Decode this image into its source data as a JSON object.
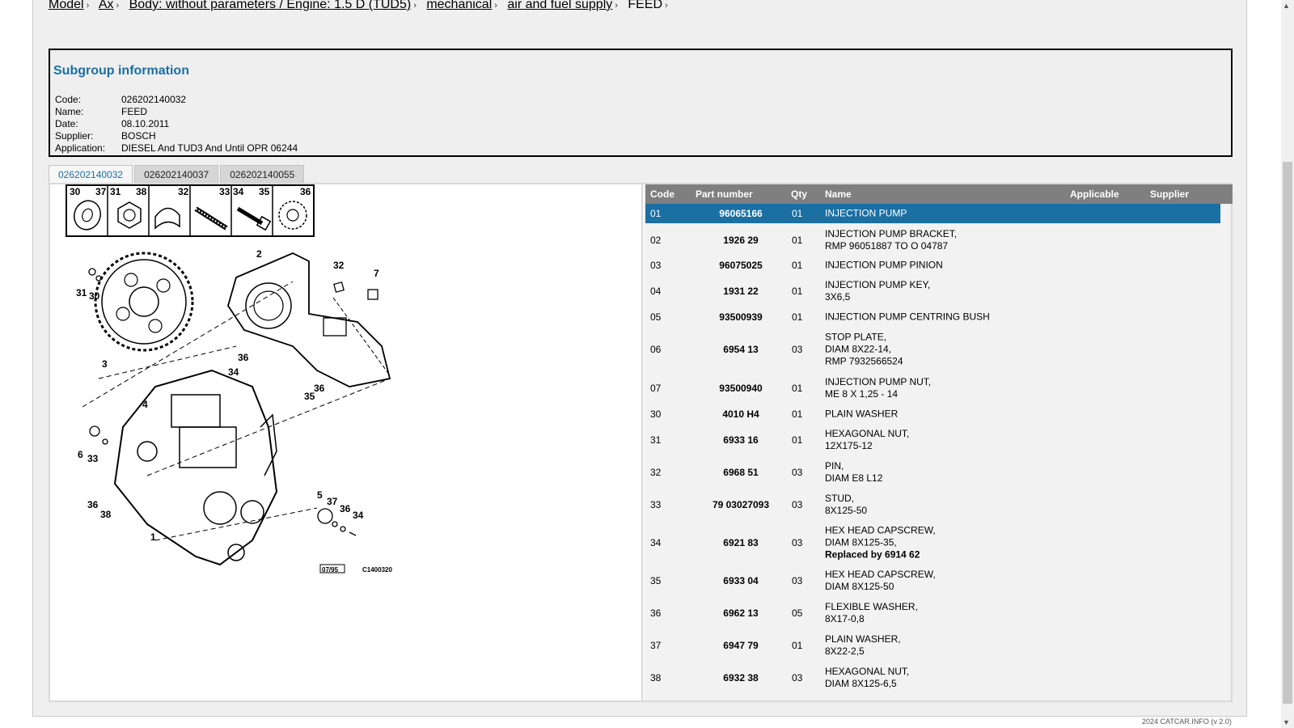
{
  "breadcrumb": {
    "items": [
      "Model",
      "Ax",
      "Body: without parameters / Engine: 1.5 D (TUD5)",
      "mechanical",
      "air and fuel supply"
    ],
    "current": "FEED",
    "separator": "›"
  },
  "subgroup": {
    "title": "Subgroup information",
    "fields": [
      {
        "label": "Code:",
        "value": "026202140032"
      },
      {
        "label": "Name:",
        "value": "FEED"
      },
      {
        "label": "Date:",
        "value": "08.10.2011"
      },
      {
        "label": "Supplier:",
        "value": "BOSCH"
      },
      {
        "label": "Application:",
        "value": "DIESEL And TUD3 And Until OPR 06244"
      }
    ]
  },
  "tabs": [
    {
      "label": "026202140032",
      "active": true
    },
    {
      "label": "026202140037",
      "active": false
    },
    {
      "label": "026202140055",
      "active": false
    }
  ],
  "diagram": {
    "legend_numbers": [
      "30",
      "37",
      "31",
      "38",
      "32",
      "33",
      "34",
      "35",
      "36"
    ],
    "callouts": [
      "2",
      "32",
      "7",
      "31",
      "30",
      "3",
      "36",
      "34",
      "4",
      "36",
      "35",
      "6",
      "33",
      "5",
      "37",
      "36",
      "34",
      "36",
      "38",
      "1"
    ],
    "stamp_date": "07/95",
    "ref_code": "C1400320"
  },
  "parts_table": {
    "columns": {
      "code": "Code",
      "part": "Part number",
      "qty": "Qty",
      "name": "Name",
      "applicable": "Applicable",
      "supplier": "Supplier"
    },
    "rows": [
      {
        "code": "01",
        "part": "96065166",
        "qty": "01",
        "name": [
          "INJECTION PUMP"
        ],
        "selected": true
      },
      {
        "code": "02",
        "part": "1926 29",
        "qty": "01",
        "name": [
          "INJECTION PUMP BRACKET,",
          "RMP 96051887 TO O 04787"
        ]
      },
      {
        "code": "03",
        "part": "96075025",
        "qty": "01",
        "name": [
          "INJECTION PUMP PINION"
        ]
      },
      {
        "code": "04",
        "part": "1931 22",
        "qty": "01",
        "name": [
          "INJECTION PUMP KEY,",
          "3X6,5"
        ]
      },
      {
        "code": "05",
        "part": "93500939",
        "qty": "01",
        "name": [
          "INJECTION PUMP CENTRING BUSH"
        ]
      },
      {
        "code": "06",
        "part": "6954 13",
        "qty": "03",
        "name": [
          "STOP PLATE,",
          "DIAM 8X22-14,",
          "RMP 7932566524"
        ]
      },
      {
        "code": "07",
        "part": "93500940",
        "qty": "01",
        "name": [
          "INJECTION PUMP NUT,",
          "ME 8 X 1,25 - 14"
        ]
      },
      {
        "code": "30",
        "part": "4010 H4",
        "qty": "01",
        "name": [
          "PLAIN WASHER"
        ]
      },
      {
        "code": "31",
        "part": "6933 16",
        "qty": "01",
        "name": [
          "HEXAGONAL NUT,",
          "12X175-12"
        ]
      },
      {
        "code": "32",
        "part": "6968 51",
        "qty": "03",
        "name": [
          "PIN,",
          "DIAM E8 L12"
        ]
      },
      {
        "code": "33",
        "part": "79 03027093",
        "qty": "03",
        "name": [
          "STUD,",
          "8X125-50"
        ]
      },
      {
        "code": "34",
        "part": "6921 83",
        "qty": "03",
        "name": [
          "HEX HEAD CAPSCREW,",
          "DIAM 8X125-35,"
        ],
        "replaced": "Replaced by 6914 62"
      },
      {
        "code": "35",
        "part": "6933 04",
        "qty": "03",
        "name": [
          "HEX HEAD CAPSCREW,",
          "DIAM 8X125-50"
        ]
      },
      {
        "code": "36",
        "part": "6962 13",
        "qty": "05",
        "name": [
          "FLEXIBLE WASHER,",
          "8X17-0,8"
        ]
      },
      {
        "code": "37",
        "part": "6947 79",
        "qty": "01",
        "name": [
          "PLAIN WASHER,",
          "8X22-2,5"
        ]
      },
      {
        "code": "38",
        "part": "6932 38",
        "qty": "03",
        "name": [
          "HEXAGONAL NUT,",
          "DIAM 8X125-6,5"
        ]
      }
    ]
  },
  "footer": "2024 CATCAR.INFO (v 2.0)",
  "colors": {
    "accent": "#1a6fa3",
    "header_bg": "#7f7f7f",
    "panel_bg": "#efefef"
  }
}
